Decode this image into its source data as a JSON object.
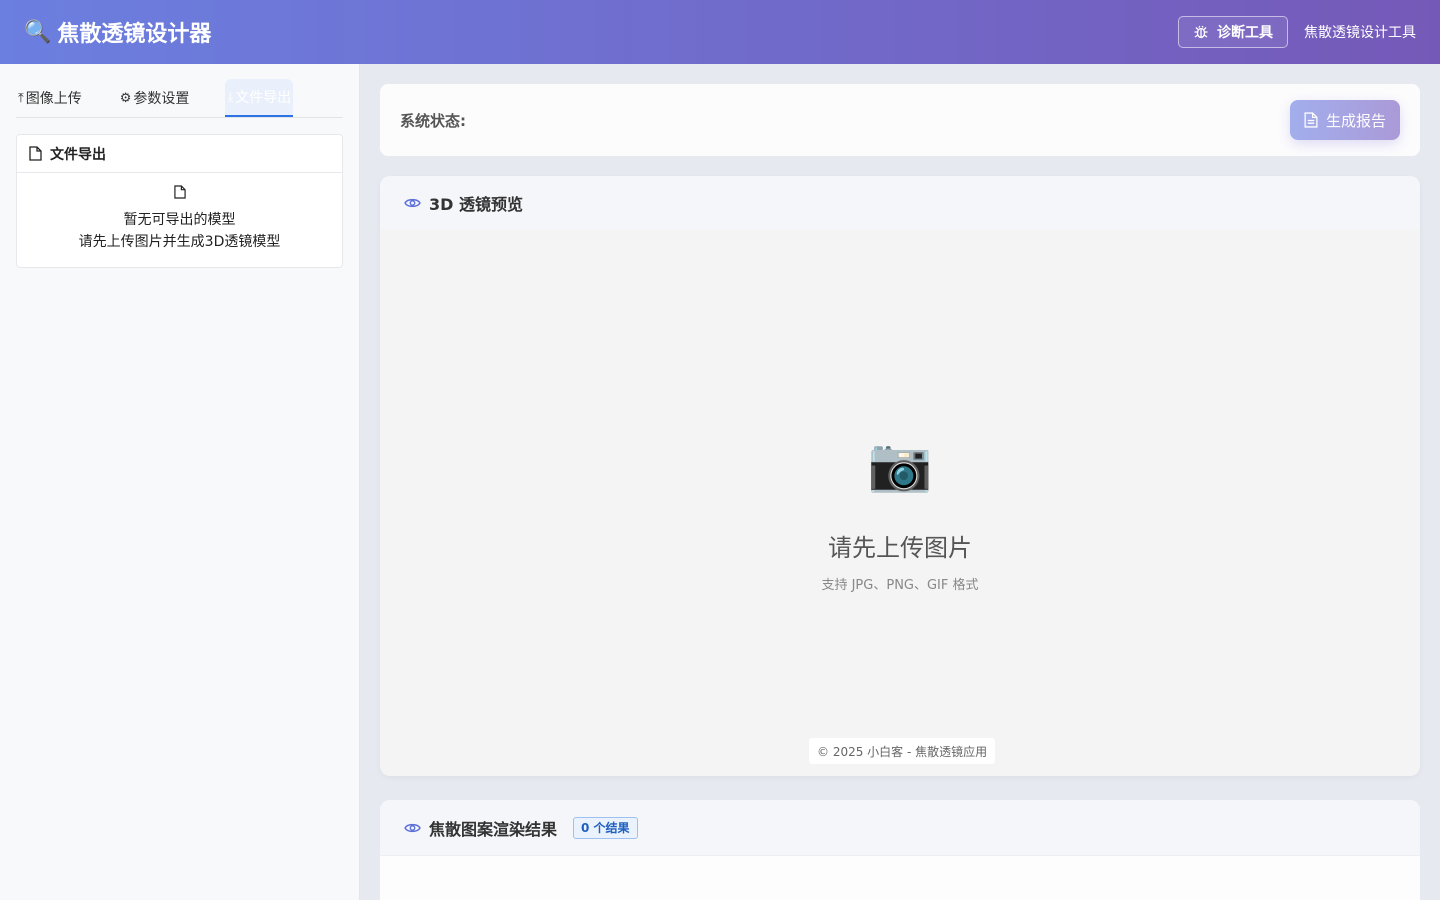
{
  "header": {
    "logo_emoji": "🔍",
    "title": "焦散透镜设计器",
    "diag_button_label": "诊断工具",
    "subtitle": "焦散透镜设计工具"
  },
  "sidebar": {
    "tabs": [
      {
        "label": "图像上传",
        "icon": "upload-icon",
        "glyph": "⤒"
      },
      {
        "label": "参数设置",
        "icon": "gear-icon",
        "glyph": "⚙"
      },
      {
        "label": "文件导出",
        "icon": "download-icon",
        "glyph": "⤓",
        "active": true
      }
    ],
    "export_card": {
      "title": "文件导出",
      "empty_line1": "暂无可导出的模型",
      "empty_line2": "请先上传图片并生成3D透镜模型"
    }
  },
  "main": {
    "status_label": "系统状态:",
    "report_button_label": "生成报告",
    "preview": {
      "title": "3D 透镜预览",
      "camera_emoji": "📷",
      "empty_title": "请先上传图片",
      "empty_sub": "支持 JPG、PNG、GIF 格式",
      "copyright": "© 2025 小白客 - 焦散透镜应用"
    },
    "results": {
      "title": "焦散图案渲染结果",
      "count_badge": "0 个结果"
    }
  },
  "colors": {
    "header_gradient_start": "#6b7fe0",
    "header_gradient_end": "#7559b8",
    "active_tab_underline": "#2c74e6",
    "badge_text": "#1f5fbf"
  }
}
